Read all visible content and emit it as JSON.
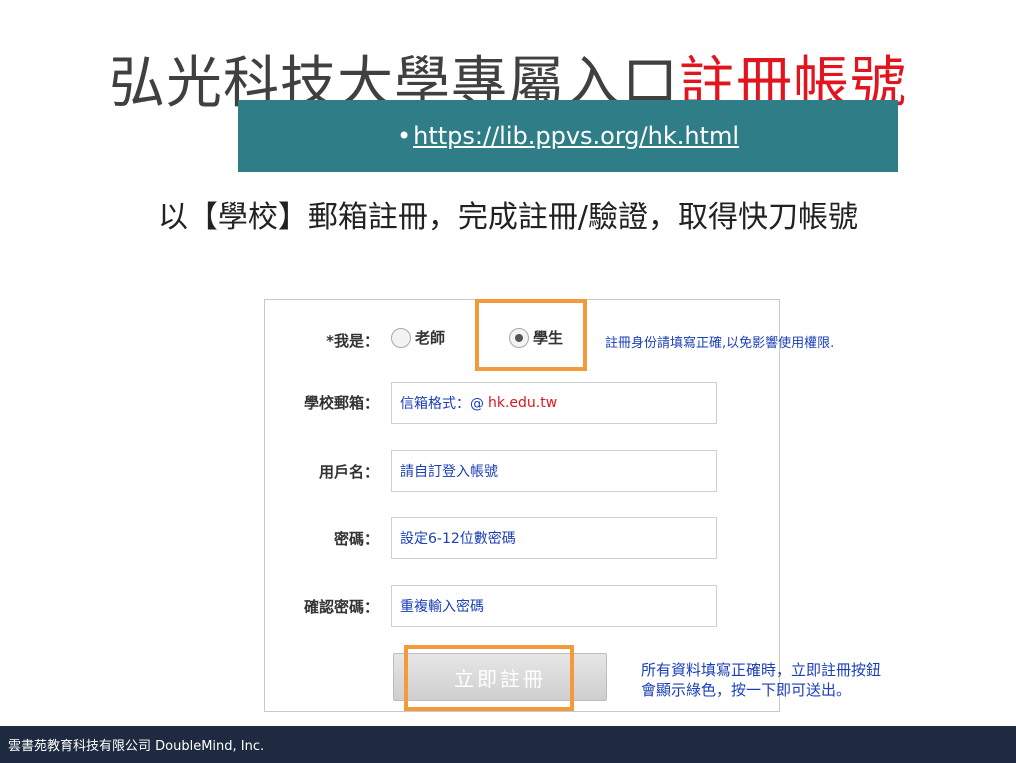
{
  "slide": {
    "title_main": "弘光科技大學專屬入口",
    "title_accent": "註冊帳號",
    "url_bullet": "•",
    "url": "https://lib.ppvs.org/hk.html",
    "instruction": "以【學校】郵箱註冊，完成註冊/驗證，取得快刀帳號"
  },
  "form": {
    "identity_label": "*我是：",
    "option_teacher": "老師",
    "option_student": "學生",
    "selected": "學生",
    "identity_note": "註冊身份請填寫正確,以免影響使用權限.",
    "email_label": "學校郵箱：",
    "email_placeholder": "信箱格式：@",
    "email_domain": "hk.edu.tw",
    "username_label": "用戶名：",
    "username_placeholder": "請自訂登入帳號",
    "password_label": "密碼：",
    "password_placeholder": "設定6-12位數密碼",
    "confirm_label": "確認密碼：",
    "confirm_placeholder": "重複輸入密碼",
    "submit_label": "立即註冊",
    "submit_note_line1": "所有資料填寫正確時，立即註冊按鈕",
    "submit_note_line2": "會顯示綠色，按一下即可送出。"
  },
  "footer": {
    "company": "雲書苑教育科技有限公司 DoubleMind, Inc."
  },
  "colors": {
    "accent_red": "#e2141e",
    "url_box": "#2e7d87",
    "highlight": "#f39a3c",
    "note_blue": "#1a3fb8",
    "footer_bg": "#1d2a40"
  }
}
